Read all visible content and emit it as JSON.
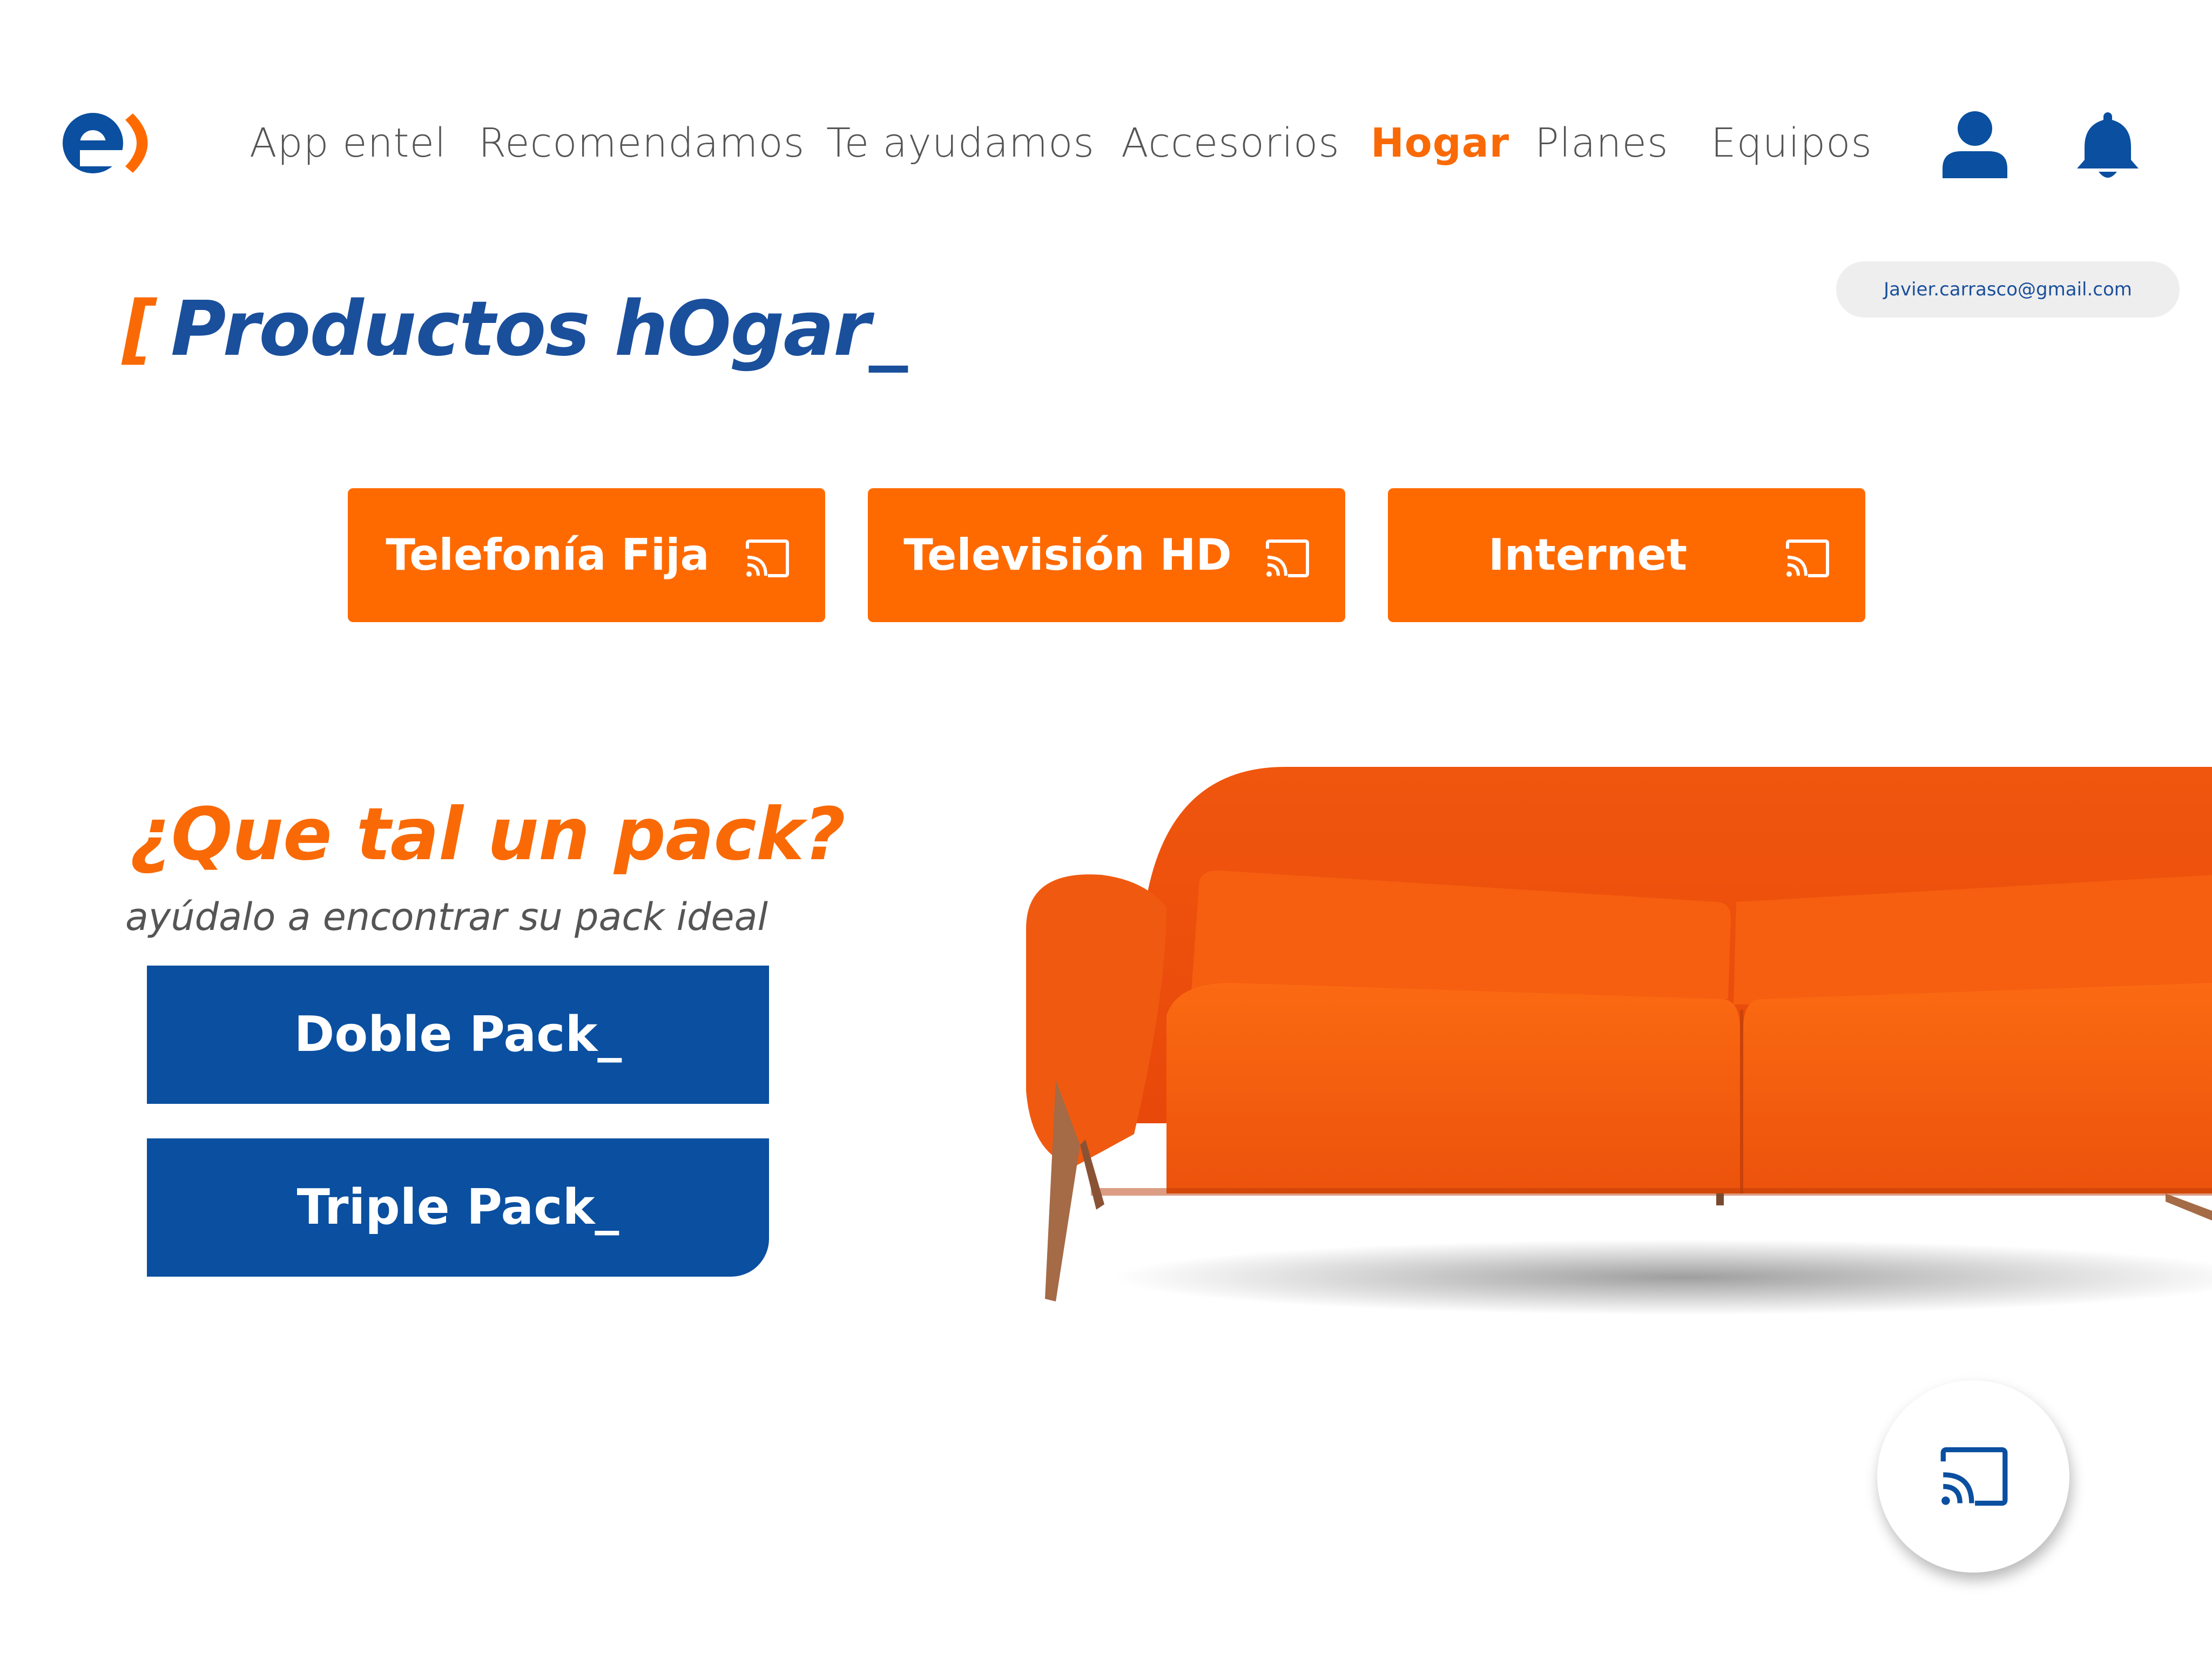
{
  "brand": {
    "logo_icon": "entel-logo",
    "colors": {
      "blue": "#0a4fa0",
      "orange": "#ff6a00"
    }
  },
  "nav": {
    "items": [
      {
        "label": "App entel",
        "active": false
      },
      {
        "label": "Recomendamos",
        "active": false
      },
      {
        "label": "Te ayudamos",
        "active": false
      },
      {
        "label": "Accesorios",
        "active": false
      },
      {
        "label": "Hogar",
        "active": true
      },
      {
        "label": "Planes",
        "active": false
      },
      {
        "label": "Equipos",
        "active": false
      }
    ],
    "user_icon": "user-icon",
    "bell_icon": "bell-icon"
  },
  "user": {
    "email": "Javier.carrasco@gmail.com"
  },
  "page": {
    "title_bracket": "[",
    "title": "Productos hOgar_"
  },
  "products": [
    {
      "label": "Telefonía Fija",
      "icon": "cast-icon"
    },
    {
      "label": "Televisión HD",
      "icon": "cast-icon"
    },
    {
      "label": "Internet",
      "icon": "cast-icon"
    }
  ],
  "pack": {
    "question": "¿Que tal un pack?",
    "subtitle": "ayúdalo a encontrar su pack ideal",
    "buttons": [
      {
        "label": "Doble Pack_"
      },
      {
        "label": "Triple Pack_"
      }
    ]
  },
  "fab": {
    "icon": "cast-icon"
  }
}
